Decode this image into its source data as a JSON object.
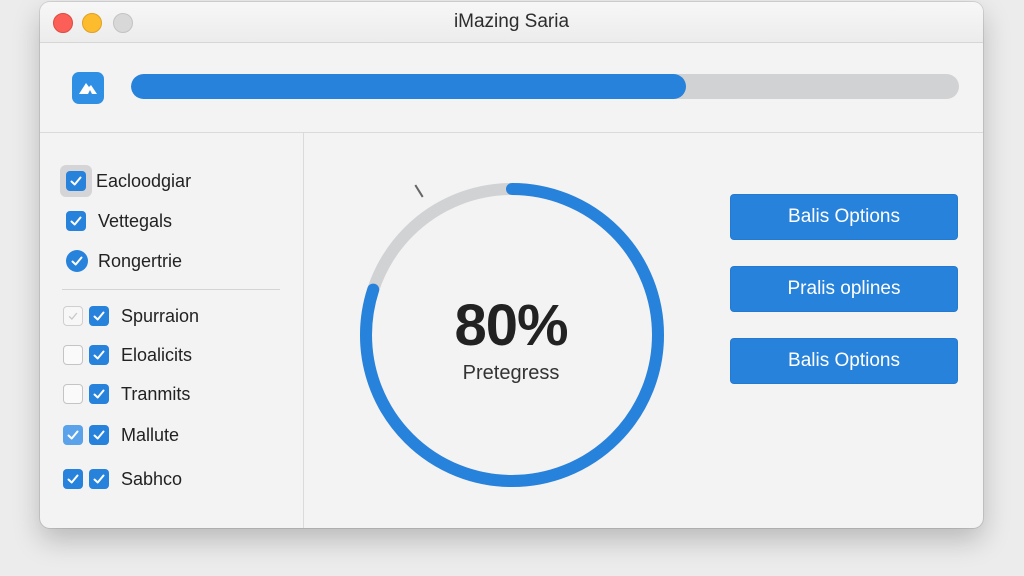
{
  "window": {
    "title": "iMazing Saria"
  },
  "progress": {
    "top_fraction": 0.67,
    "ring_percent_value": 0.8,
    "ring_percent_label": "80%",
    "ring_caption": "Pretegress"
  },
  "sidebar": {
    "group1": [
      {
        "label": "Eacloodgiar",
        "checked": true
      },
      {
        "label": "Vettegals",
        "checked": true
      },
      {
        "label": "Rongertrie",
        "checked": true
      }
    ],
    "group2": [
      {
        "label": "Spurraion",
        "outer_checked": false,
        "inner_checked": true
      },
      {
        "label": "Eloalicits",
        "outer_checked": false,
        "inner_checked": true
      },
      {
        "label": "Tranmits",
        "outer_checked": false,
        "inner_checked": true
      },
      {
        "label": "Mallute",
        "outer_checked": true,
        "inner_checked": true
      },
      {
        "label": "Sabhco",
        "outer_checked": true,
        "inner_checked": true
      }
    ]
  },
  "buttons": [
    {
      "label": "Balis Options"
    },
    {
      "label": "Pralis oplines"
    },
    {
      "label": "Balis Options"
    }
  ],
  "colors": {
    "accent": "#2782dc",
    "track": "#d1d2d4"
  }
}
